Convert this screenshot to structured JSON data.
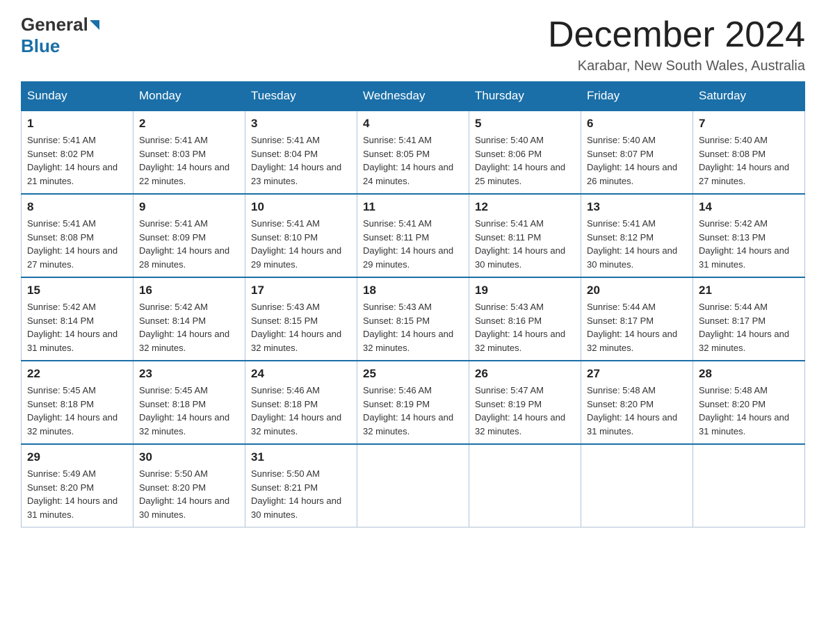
{
  "header": {
    "logo_general": "General",
    "logo_blue": "Blue",
    "main_title": "December 2024",
    "subtitle": "Karabar, New South Wales, Australia"
  },
  "calendar": {
    "days_of_week": [
      "Sunday",
      "Monday",
      "Tuesday",
      "Wednesday",
      "Thursday",
      "Friday",
      "Saturday"
    ],
    "weeks": [
      [
        {
          "day": "1",
          "sunrise": "5:41 AM",
          "sunset": "8:02 PM",
          "daylight": "14 hours and 21 minutes."
        },
        {
          "day": "2",
          "sunrise": "5:41 AM",
          "sunset": "8:03 PM",
          "daylight": "14 hours and 22 minutes."
        },
        {
          "day": "3",
          "sunrise": "5:41 AM",
          "sunset": "8:04 PM",
          "daylight": "14 hours and 23 minutes."
        },
        {
          "day": "4",
          "sunrise": "5:41 AM",
          "sunset": "8:05 PM",
          "daylight": "14 hours and 24 minutes."
        },
        {
          "day": "5",
          "sunrise": "5:40 AM",
          "sunset": "8:06 PM",
          "daylight": "14 hours and 25 minutes."
        },
        {
          "day": "6",
          "sunrise": "5:40 AM",
          "sunset": "8:07 PM",
          "daylight": "14 hours and 26 minutes."
        },
        {
          "day": "7",
          "sunrise": "5:40 AM",
          "sunset": "8:08 PM",
          "daylight": "14 hours and 27 minutes."
        }
      ],
      [
        {
          "day": "8",
          "sunrise": "5:41 AM",
          "sunset": "8:08 PM",
          "daylight": "14 hours and 27 minutes."
        },
        {
          "day": "9",
          "sunrise": "5:41 AM",
          "sunset": "8:09 PM",
          "daylight": "14 hours and 28 minutes."
        },
        {
          "day": "10",
          "sunrise": "5:41 AM",
          "sunset": "8:10 PM",
          "daylight": "14 hours and 29 minutes."
        },
        {
          "day": "11",
          "sunrise": "5:41 AM",
          "sunset": "8:11 PM",
          "daylight": "14 hours and 29 minutes."
        },
        {
          "day": "12",
          "sunrise": "5:41 AM",
          "sunset": "8:11 PM",
          "daylight": "14 hours and 30 minutes."
        },
        {
          "day": "13",
          "sunrise": "5:41 AM",
          "sunset": "8:12 PM",
          "daylight": "14 hours and 30 minutes."
        },
        {
          "day": "14",
          "sunrise": "5:42 AM",
          "sunset": "8:13 PM",
          "daylight": "14 hours and 31 minutes."
        }
      ],
      [
        {
          "day": "15",
          "sunrise": "5:42 AM",
          "sunset": "8:14 PM",
          "daylight": "14 hours and 31 minutes."
        },
        {
          "day": "16",
          "sunrise": "5:42 AM",
          "sunset": "8:14 PM",
          "daylight": "14 hours and 32 minutes."
        },
        {
          "day": "17",
          "sunrise": "5:43 AM",
          "sunset": "8:15 PM",
          "daylight": "14 hours and 32 minutes."
        },
        {
          "day": "18",
          "sunrise": "5:43 AM",
          "sunset": "8:15 PM",
          "daylight": "14 hours and 32 minutes."
        },
        {
          "day": "19",
          "sunrise": "5:43 AM",
          "sunset": "8:16 PM",
          "daylight": "14 hours and 32 minutes."
        },
        {
          "day": "20",
          "sunrise": "5:44 AM",
          "sunset": "8:17 PM",
          "daylight": "14 hours and 32 minutes."
        },
        {
          "day": "21",
          "sunrise": "5:44 AM",
          "sunset": "8:17 PM",
          "daylight": "14 hours and 32 minutes."
        }
      ],
      [
        {
          "day": "22",
          "sunrise": "5:45 AM",
          "sunset": "8:18 PM",
          "daylight": "14 hours and 32 minutes."
        },
        {
          "day": "23",
          "sunrise": "5:45 AM",
          "sunset": "8:18 PM",
          "daylight": "14 hours and 32 minutes."
        },
        {
          "day": "24",
          "sunrise": "5:46 AM",
          "sunset": "8:18 PM",
          "daylight": "14 hours and 32 minutes."
        },
        {
          "day": "25",
          "sunrise": "5:46 AM",
          "sunset": "8:19 PM",
          "daylight": "14 hours and 32 minutes."
        },
        {
          "day": "26",
          "sunrise": "5:47 AM",
          "sunset": "8:19 PM",
          "daylight": "14 hours and 32 minutes."
        },
        {
          "day": "27",
          "sunrise": "5:48 AM",
          "sunset": "8:20 PM",
          "daylight": "14 hours and 31 minutes."
        },
        {
          "day": "28",
          "sunrise": "5:48 AM",
          "sunset": "8:20 PM",
          "daylight": "14 hours and 31 minutes."
        }
      ],
      [
        {
          "day": "29",
          "sunrise": "5:49 AM",
          "sunset": "8:20 PM",
          "daylight": "14 hours and 31 minutes."
        },
        {
          "day": "30",
          "sunrise": "5:50 AM",
          "sunset": "8:20 PM",
          "daylight": "14 hours and 30 minutes."
        },
        {
          "day": "31",
          "sunrise": "5:50 AM",
          "sunset": "8:21 PM",
          "daylight": "14 hours and 30 minutes."
        },
        null,
        null,
        null,
        null
      ]
    ]
  }
}
